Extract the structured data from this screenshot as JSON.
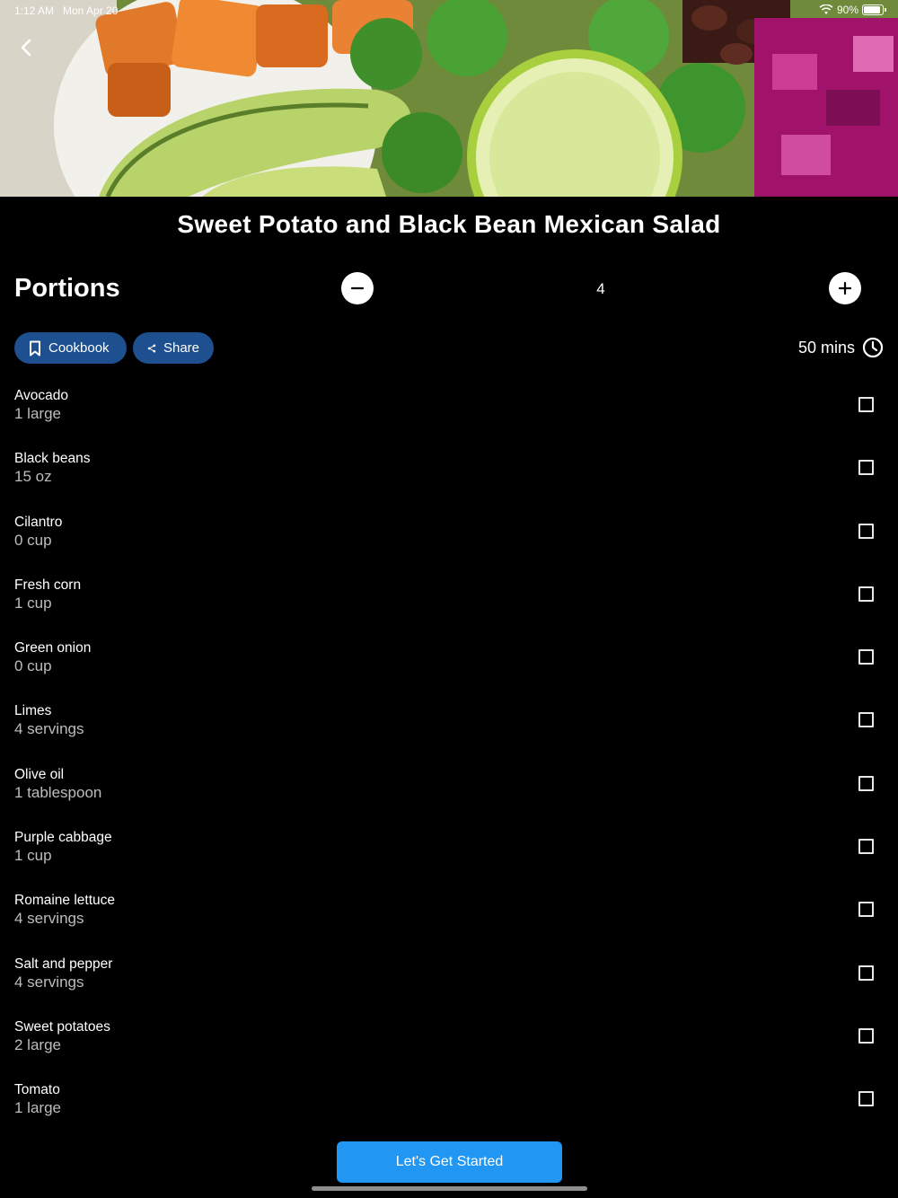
{
  "status_bar": {
    "time": "1:12 AM",
    "date": "Mon Apr 20",
    "battery": "90%"
  },
  "hero": {
    "image_name": "salad-photo"
  },
  "recipe": {
    "title": "Sweet Potato and Black Bean Mexican Salad"
  },
  "portions": {
    "label": "Portions",
    "value": "4"
  },
  "actions": {
    "cookbook_label": "Cookbook",
    "share_label": "Share"
  },
  "time": {
    "label": "50 mins"
  },
  "ingredients": [
    {
      "name": "Avocado",
      "qty": "1 large",
      "checked": false
    },
    {
      "name": "Black beans",
      "qty": "15 oz",
      "checked": false
    },
    {
      "name": "Cilantro",
      "qty": "0 cup",
      "checked": false
    },
    {
      "name": "Fresh corn",
      "qty": "1 cup",
      "checked": false
    },
    {
      "name": "Green onion",
      "qty": "0 cup",
      "checked": false
    },
    {
      "name": "Limes",
      "qty": "4 servings",
      "checked": false
    },
    {
      "name": "Olive oil",
      "qty": "1 tablespoon",
      "checked": false
    },
    {
      "name": "Purple cabbage",
      "qty": "1 cup",
      "checked": false
    },
    {
      "name": "Romaine lettuce",
      "qty": "4 servings",
      "checked": false
    },
    {
      "name": "Salt and pepper",
      "qty": "4 servings",
      "checked": false
    },
    {
      "name": "Sweet potatoes",
      "qty": "2 large",
      "checked": false
    },
    {
      "name": "Tomato",
      "qty": "1 large",
      "checked": false
    }
  ],
  "footer": {
    "start_label": "Let's Get Started"
  },
  "colors": {
    "accent": "#2196f3",
    "pill_bg": "#1e4f8f",
    "background": "#000000"
  }
}
